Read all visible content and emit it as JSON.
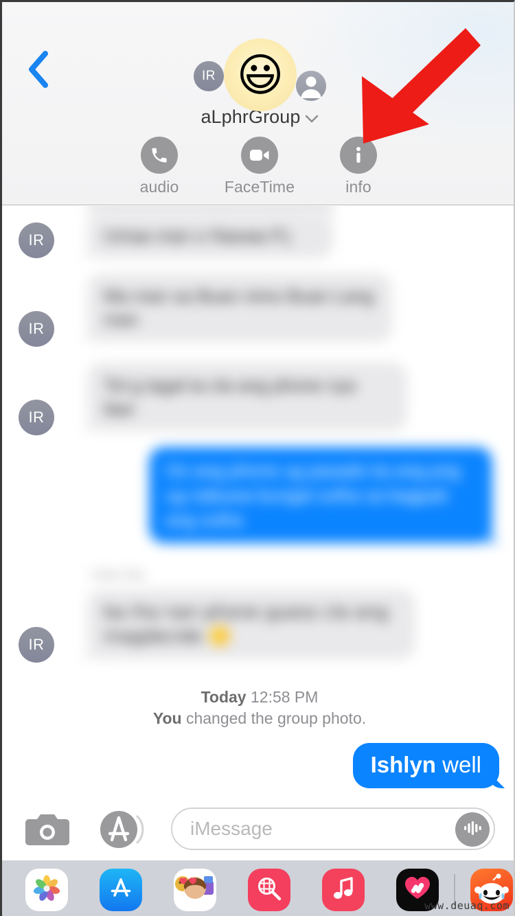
{
  "app": {
    "name": "Messages",
    "platform": "iOS"
  },
  "header": {
    "back_label": "Back",
    "back_icon": "chevron-left-icon",
    "group_name": "aLphrGroup",
    "group_chevron_icon": "chevron-down-icon",
    "avatars": [
      {
        "type": "initials",
        "label": "IR"
      },
      {
        "type": "emoji",
        "label": "😃"
      },
      {
        "type": "person-silhouette",
        "label": ""
      }
    ],
    "actions": [
      {
        "id": "audio",
        "label": "audio",
        "icon": "phone-icon"
      },
      {
        "id": "facetime",
        "label": "FaceTime",
        "icon": "video-camera-icon"
      },
      {
        "id": "info",
        "label": "info",
        "icon": "info-circle-icon"
      }
    ]
  },
  "annotation": {
    "type": "arrow",
    "color": "#ED1C16",
    "points_to": "info"
  },
  "conversation": {
    "messages": [
      {
        "id": "m0",
        "direction": "incoming",
        "avatar": "",
        "text": "",
        "blurred": true,
        "partial": true
      },
      {
        "id": "m1",
        "direction": "incoming",
        "avatar": "IR",
        "text": "Umaa man o Nawaa P.j",
        "blurred": true
      },
      {
        "id": "m2",
        "direction": "incoming",
        "avatar": "IR",
        "text": "Ma man sa Buan nimo Buan Lang man",
        "blurred": true
      },
      {
        "id": "m3",
        "direction": "incoming",
        "avatar": "IR",
        "text": "Tol g tagal ta cla ang phone nya ilaw",
        "blurred": true
      },
      {
        "id": "m4",
        "direction": "outgoing",
        "text": "Oo ang phone ug pasado ka ang png ug nabuwa bungat sulha sa bagpait ang sulha",
        "blurred": true
      },
      {
        "id": "m5",
        "direction": "incoming",
        "avatar": "IR",
        "sender_tag": "Ishlyn Bay",
        "text": "ba iha nan phone guess cla ang magdecide 🟡",
        "blurred": true
      }
    ],
    "system_event": {
      "timestamp_prefix": "Today",
      "timestamp": "12:58 PM",
      "actor": "You",
      "action": " changed the group photo."
    },
    "last_outgoing": {
      "strong_word": "Ishlyn",
      "rest_word": " well"
    }
  },
  "input_bar": {
    "camera_icon": "camera-icon",
    "appstore_icon": "app-store-icon",
    "placeholder": "iMessage",
    "value": "",
    "mic_icon": "audio-waveform-icon"
  },
  "app_drawer": {
    "apps": [
      {
        "id": "photos",
        "icon": "photos-icon"
      },
      {
        "id": "app-store",
        "icon": "app-store-icon"
      },
      {
        "id": "memoji",
        "icon": "memoji-stickers-icon"
      },
      {
        "id": "images",
        "icon": "images-search-icon"
      },
      {
        "id": "apple-music",
        "icon": "music-note-icon"
      },
      {
        "id": "digital-touch",
        "icon": "digital-touch-heart-icon"
      },
      {
        "id": "reddit",
        "icon": "reddit-icon"
      }
    ]
  },
  "watermark": {
    "text": "www.deuaq.com"
  },
  "colors": {
    "accent_blue": "#0B84FF",
    "bubble_incoming": "#E9E9EB",
    "header_bg": "#F4F4F5",
    "drawer_bg": "#CFD2D8",
    "annotation_red": "#ED1C16",
    "avatar_gray": "#8A8D9A"
  }
}
